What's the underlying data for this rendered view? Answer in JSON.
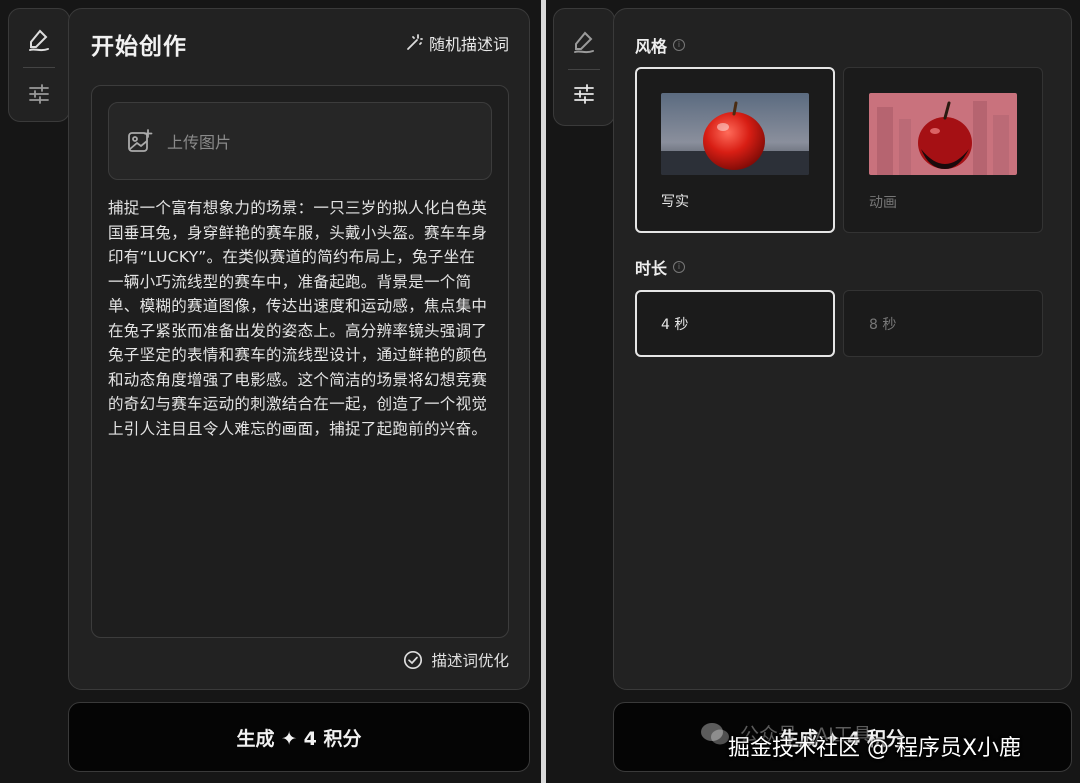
{
  "left_panel": {
    "title": "开始创作",
    "random_prompt_label": "随机描述词",
    "upload_label": "上传图片",
    "prompt_text": "捕捉一个富有想象力的场景：一只三岁的拟人化白色英国垂耳兔，身穿鲜艳的赛车服，头戴小头盔。赛车车身印有“LUCKY”。在类似赛道的简约布局上，兔子坐在一辆小巧流线型的赛车中，准备起跑。背景是一个简单、模糊的赛道图像，传达出速度和运动感，焦点集中在兔子紧张而准备出发的姿态上。高分辨率镜头强调了兔子坚定的表情和赛车的流线型设计，通过鲜艳的颜色和动态角度增强了电影感。这个简洁的场景将幻想竞赛的奇幻与赛车运动的刺激结合在一起，创造了一个视觉上引人注目且令人难忘的画面，捕捉了起跑前的兴奋。",
    "optimize_label": "描述词优化",
    "generate_label": "生成 ✦ 4 积分"
  },
  "right_panel": {
    "style_label": "风格",
    "style_options": [
      {
        "label": "写实",
        "selected": true
      },
      {
        "label": "动画",
        "selected": false
      }
    ],
    "duration_label": "时长",
    "duration_options": [
      {
        "label": "4 秒",
        "selected": true
      },
      {
        "label": "8 秒",
        "selected": false
      }
    ],
    "generate_label": "生成 ✦ 4 积分"
  },
  "watermark": {
    "text": "掘金技术社区 @ 程序员X小鹿",
    "faint_text": "公众号 · AI工具"
  },
  "icons": {
    "create": "pen-scribble-icon",
    "settings": "sliders-icon",
    "magic": "magic-wand-icon",
    "image": "image-add-icon",
    "check": "check-circle-icon"
  }
}
